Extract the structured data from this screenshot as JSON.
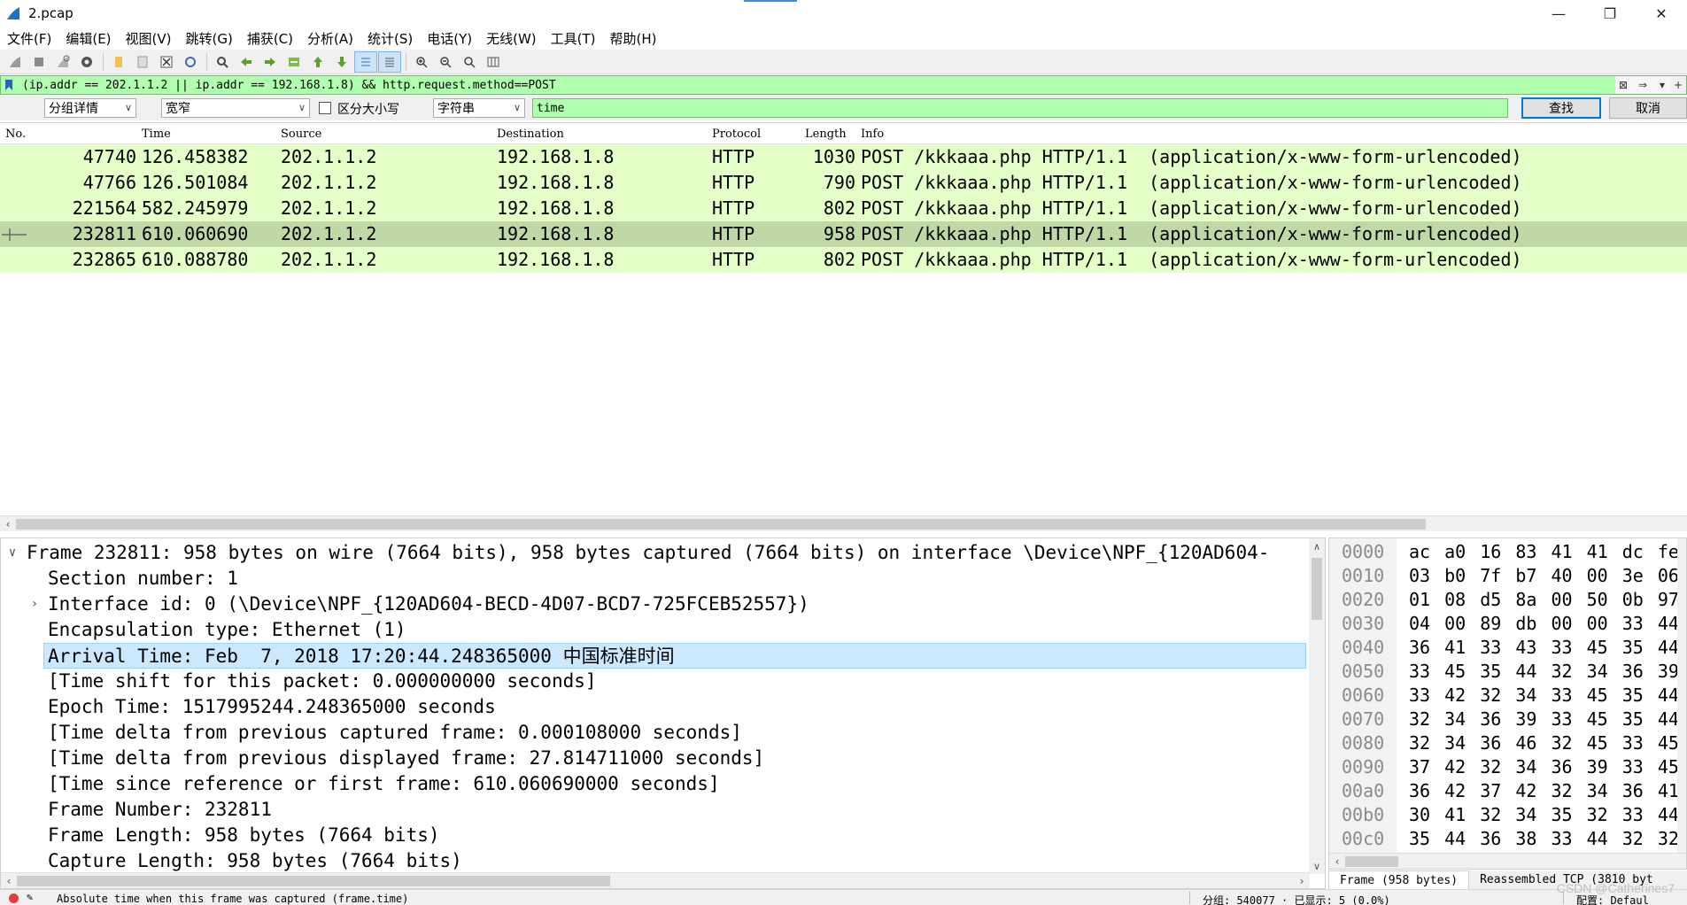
{
  "window": {
    "title": "2.pcap",
    "minimize": "—",
    "restore": "❐",
    "close": "✕"
  },
  "menu": [
    "文件(F)",
    "编辑(E)",
    "视图(V)",
    "跳转(G)",
    "捕获(C)",
    "分析(A)",
    "统计(S)",
    "电话(Y)",
    "无线(W)",
    "工具(T)",
    "帮助(H)"
  ],
  "filter": {
    "text": "(ip.addr == 202.1.1.2 || ip.addr == 192.168.1.8) && http.request.method==POST",
    "background": "#afffaf"
  },
  "find": {
    "search_in": "分组详情",
    "char_width": "宽窄",
    "case_sensitive_label": "区分大小写",
    "search_type": "字符串",
    "query": "time",
    "find_button": "查找",
    "cancel_button": "取消"
  },
  "packet_list": {
    "columns": [
      "No.",
      "Time",
      "Source",
      "Destination",
      "Protocol",
      "Length",
      "Info"
    ],
    "rows": [
      {
        "no": "47740",
        "time": "126.458382",
        "src": "202.1.1.2",
        "dst": "192.168.1.8",
        "proto": "HTTP",
        "len": "1030",
        "info": "POST /kkkaaa.php HTTP/1.1  (application/x-www-form-urlencoded)",
        "selected": false
      },
      {
        "no": "47766",
        "time": "126.501084",
        "src": "202.1.1.2",
        "dst": "192.168.1.8",
        "proto": "HTTP",
        "len": "790",
        "info": "POST /kkkaaa.php HTTP/1.1  (application/x-www-form-urlencoded)",
        "selected": false
      },
      {
        "no": "221564",
        "time": "582.245979",
        "src": "202.1.1.2",
        "dst": "192.168.1.8",
        "proto": "HTTP",
        "len": "802",
        "info": "POST /kkkaaa.php HTTP/1.1  (application/x-www-form-urlencoded)",
        "selected": false
      },
      {
        "no": "232811",
        "time": "610.060690",
        "src": "202.1.1.2",
        "dst": "192.168.1.8",
        "proto": "HTTP",
        "len": "958",
        "info": "POST /kkkaaa.php HTTP/1.1  (application/x-www-form-urlencoded)",
        "selected": true
      },
      {
        "no": "232865",
        "time": "610.088780",
        "src": "202.1.1.2",
        "dst": "192.168.1.8",
        "proto": "HTTP",
        "len": "802",
        "info": "POST /kkkaaa.php HTTP/1.1  (application/x-www-form-urlencoded)",
        "selected": false
      }
    ]
  },
  "details": {
    "rows": [
      {
        "level": 0,
        "expander": "∨",
        "text": "Frame 232811: 958 bytes on wire (7664 bits), 958 bytes captured (7664 bits) on interface \\Device\\NPF_{120AD604-"
      },
      {
        "level": 1,
        "expander": "",
        "text": "Section number: 1"
      },
      {
        "level": 1,
        "expander": "›",
        "text": "Interface id: 0 (\\Device\\NPF_{120AD604-BECD-4D07-BCD7-725FCEB52557})"
      },
      {
        "level": 1,
        "expander": "",
        "text": "Encapsulation type: Ethernet (1)"
      },
      {
        "level": 1,
        "expander": "",
        "text": "Arrival Time: Feb  7, 2018 17:20:44.248365000 ",
        "suffix": "中国标准时间",
        "highlight": true
      },
      {
        "level": 1,
        "expander": "",
        "text": "[Time shift for this packet: 0.000000000 seconds]"
      },
      {
        "level": 1,
        "expander": "",
        "text": "Epoch Time: 1517995244.248365000 seconds"
      },
      {
        "level": 1,
        "expander": "",
        "text": "[Time delta from previous captured frame: 0.000108000 seconds]"
      },
      {
        "level": 1,
        "expander": "",
        "text": "[Time delta from previous displayed frame: 27.814711000 seconds]"
      },
      {
        "level": 1,
        "expander": "",
        "text": "[Time since reference or first frame: 610.060690000 seconds]"
      },
      {
        "level": 1,
        "expander": "",
        "text": "Frame Number: 232811"
      },
      {
        "level": 1,
        "expander": "",
        "text": "Frame Length: 958 bytes (7664 bits)"
      },
      {
        "level": 1,
        "expander": "",
        "text": "Capture Length: 958 bytes (7664 bits)"
      }
    ]
  },
  "bytes": {
    "rows": [
      {
        "offset": "0000",
        "hex": "ac a0 16 83 41 41 dc fe"
      },
      {
        "offset": "0010",
        "hex": "03 b0 7f b7 40 00 3e 06"
      },
      {
        "offset": "0020",
        "hex": "01 08 d5 8a 00 50 0b 97"
      },
      {
        "offset": "0030",
        "hex": "04 00 89 db 00 00 33 44"
      },
      {
        "offset": "0040",
        "hex": "36 41 33 43 33 45 35 44"
      },
      {
        "offset": "0050",
        "hex": "33 45 35 44 32 34 36 39"
      },
      {
        "offset": "0060",
        "hex": "33 42 32 34 33 45 35 44"
      },
      {
        "offset": "0070",
        "hex": "32 34 36 39 33 45 35 44"
      },
      {
        "offset": "0080",
        "hex": "32 34 36 46 32 45 33 45"
      },
      {
        "offset": "0090",
        "hex": "37 42 32 34 36 39 33 45"
      },
      {
        "offset": "00a0",
        "hex": "36 42 37 42 32 34 36 41"
      },
      {
        "offset": "00b0",
        "hex": "30 41 32 34 35 32 33 44"
      },
      {
        "offset": "00c0",
        "hex": "35 44 36 38 33 44 32 32"
      }
    ],
    "tabs": [
      "Frame (958 bytes)",
      "Reassembled TCP (3810 byt"
    ]
  },
  "status": {
    "hint": "Absolute time when this frame was captured (frame.time)",
    "packets": "分组: 540077 · 已显示: 5 (0.0%)",
    "profile": "配置: Defaul"
  },
  "watermark": "CSDN @Catherines7"
}
